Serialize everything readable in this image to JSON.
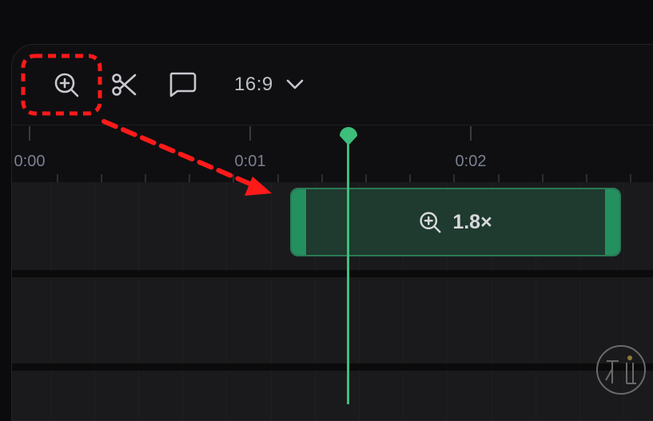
{
  "toolbar": {
    "aspect_ratio": "16:9",
    "icons": [
      "zoom-in-icon",
      "scissors-icon",
      "comment-icon",
      "chevron-down-icon"
    ]
  },
  "ruler": {
    "labels": [
      "0:00",
      "0:01",
      "0:02"
    ]
  },
  "timeline": {
    "zoom_clip": {
      "label": "1.8×",
      "icon": "zoom-in-icon"
    }
  },
  "colors": {
    "accent": "#3dbf7c",
    "clip_fill": "#1f3a2e",
    "annotation": "#ff1a1a"
  }
}
